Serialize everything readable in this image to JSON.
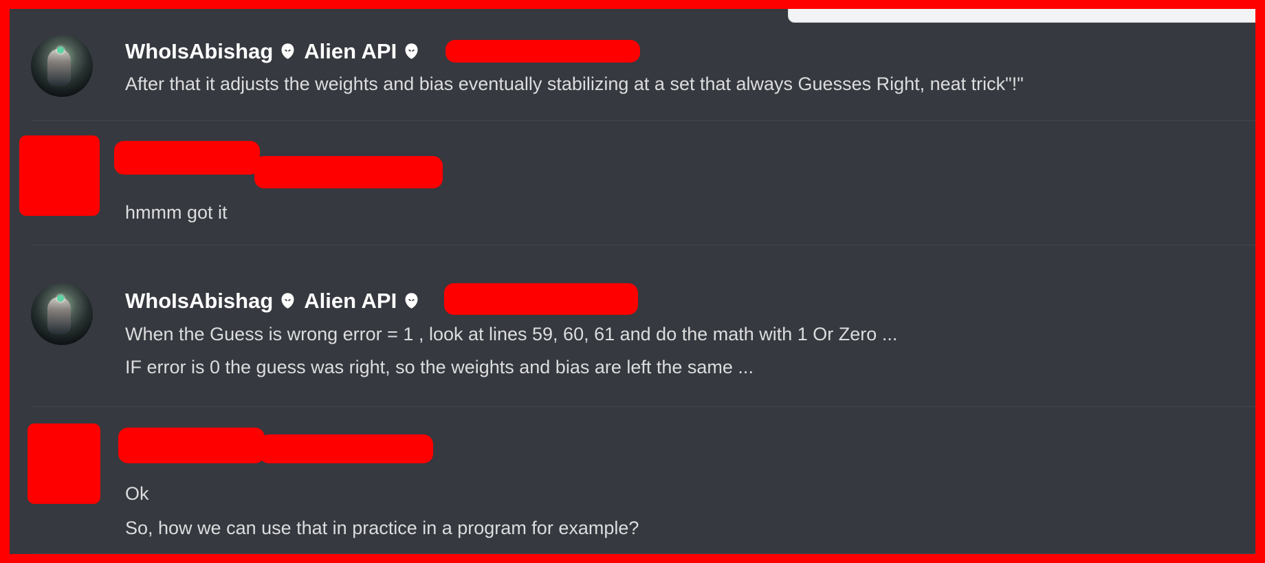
{
  "window": {
    "title": ""
  },
  "messages": [
    {
      "author": "WhoIsAbishag",
      "role": "Alien API",
      "icon_left": "alien-icon",
      "icon_right": "alien-icon",
      "lines": [
        "After that it adjusts the weights and bias eventually stabilizing at a set that always Guesses Right, neat trick\"!\""
      ]
    },
    {
      "author": "",
      "role": "",
      "icon_left": "",
      "icon_right": "",
      "lines": [
        "hmmm got it"
      ]
    },
    {
      "author": "WhoIsAbishag",
      "role": "Alien API",
      "icon_left": "alien-icon",
      "icon_right": "alien-icon",
      "lines": [
        "When the Guess is wrong error = 1 , look at lines 59, 60, 61 and do the math with 1 Or Zero ...",
        "IF error is 0 the guess was right, so the weights and bias are left the same ..."
      ]
    },
    {
      "author": "",
      "role": "",
      "icon_left": "",
      "icon_right": "",
      "lines": [
        "Ok",
        "So, how we can use that in practice in a program for example?"
      ]
    }
  ],
  "colors": {
    "background": "#36393f",
    "frame": "#ff0000",
    "text": "#dcddde",
    "username": "#ffffff"
  }
}
